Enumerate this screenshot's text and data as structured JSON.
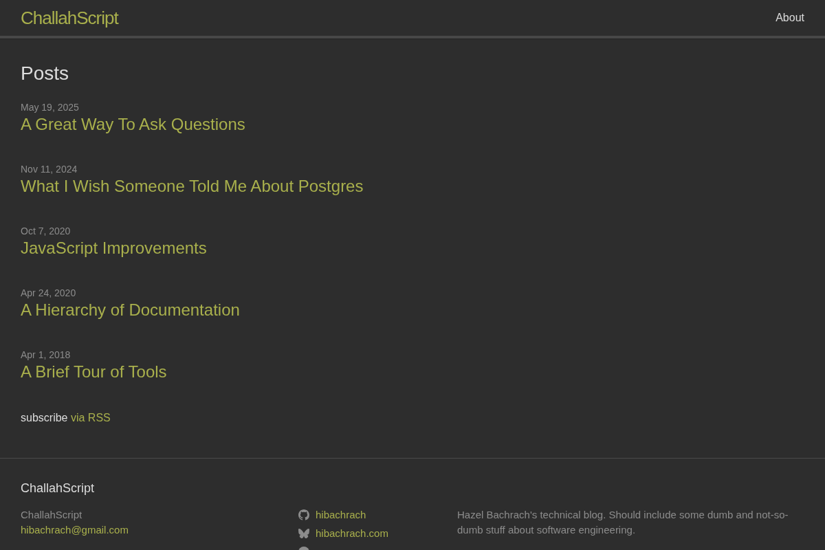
{
  "header": {
    "site_title": "ChallahScript",
    "nav": [
      {
        "label": "About"
      }
    ]
  },
  "main": {
    "heading": "Posts",
    "posts": [
      {
        "date": "May 19, 2025",
        "title": "A Great Way To Ask Questions"
      },
      {
        "date": "Nov 11, 2024",
        "title": "What I Wish Someone Told Me About Postgres"
      },
      {
        "date": "Oct 7, 2020",
        "title": "JavaScript Improvements"
      },
      {
        "date": "Apr 24, 2020",
        "title": "A Hierarchy of Documentation"
      },
      {
        "date": "Apr 1, 2018",
        "title": "A Brief Tour of Tools"
      }
    ],
    "subscribe": {
      "text": "subscribe",
      "link": "via RSS"
    }
  },
  "footer": {
    "heading": "ChallahScript",
    "site_name": "ChallahScript",
    "email": "hibachrach@gmail.com",
    "social": [
      {
        "kind": "github",
        "label": "hibachrach"
      },
      {
        "kind": "bluesky",
        "label": "hibachrach.com"
      },
      {
        "kind": "circle"
      }
    ],
    "description": "Hazel Bachrach's technical blog. Should include some dumb and not-so-dumb stuff about software engineering."
  }
}
